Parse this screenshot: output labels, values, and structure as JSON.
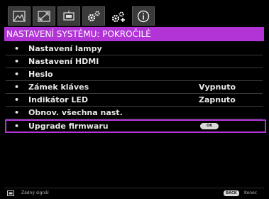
{
  "tabs": [
    {
      "icon": "picture-icon"
    },
    {
      "icon": "display-icon"
    },
    {
      "icon": "source-icon"
    },
    {
      "icon": "settings-basic-icon"
    },
    {
      "icon": "settings-advanced-icon"
    },
    {
      "icon": "info-icon"
    }
  ],
  "title": "NASTAVENÍ SYSTÉMU: POKROČILÉ",
  "menu": [
    {
      "label": "Nastavení lampy",
      "value": ""
    },
    {
      "label": "Nastavení HDMI",
      "value": ""
    },
    {
      "label": "Heslo",
      "value": ""
    },
    {
      "label": "Zámek kláves",
      "value": "Vypnuto"
    },
    {
      "label": "Indikátor LED",
      "value": "Zapnuto"
    },
    {
      "label": "Obnov. všechna nast.",
      "value": ""
    },
    {
      "label": "Upgrade firmwaru",
      "button": "OK"
    }
  ],
  "footer": {
    "source_text": "Žádný signál",
    "back_label": "BACK",
    "exit_label": "Konec"
  },
  "colors": {
    "accent": "#b233d6",
    "background": "#000000"
  }
}
